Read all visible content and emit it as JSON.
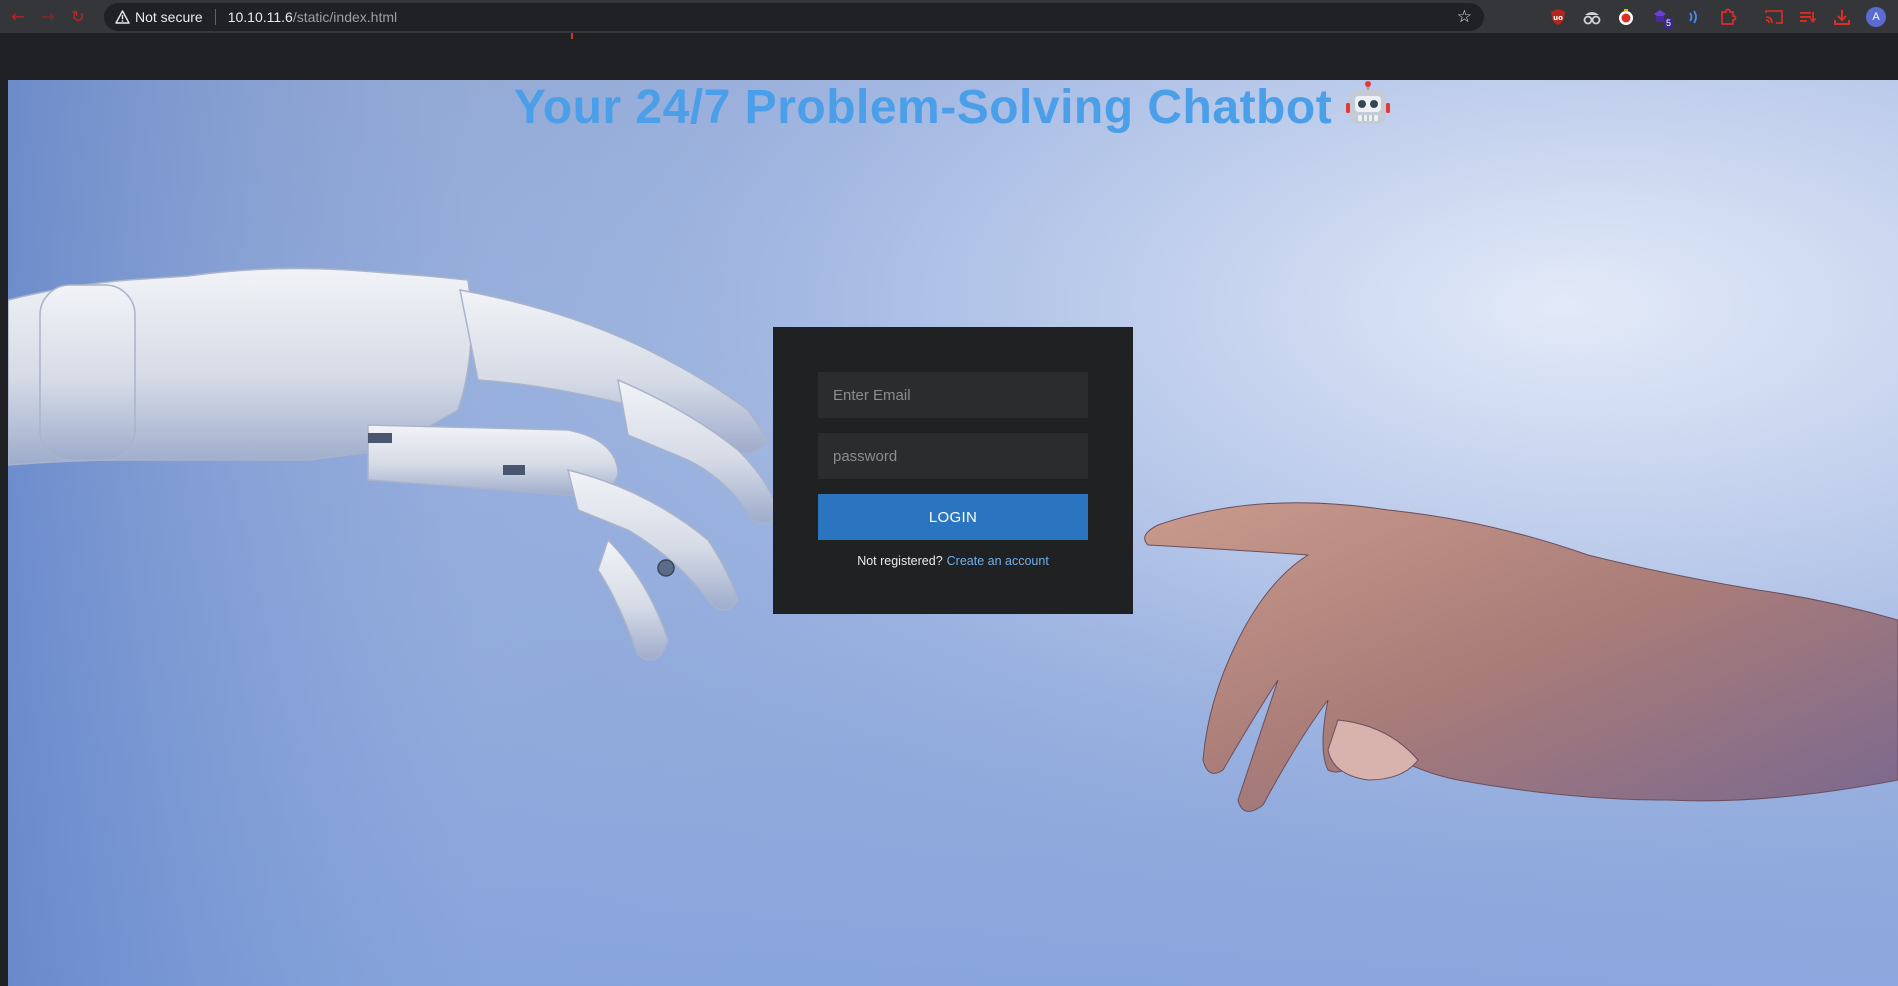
{
  "browser": {
    "security_label": "Not secure",
    "url_host": "10.10.11.6",
    "url_path": "/static/index.html",
    "accent_color": "#c5221f",
    "extensions": [
      "ublock-icon",
      "spy-icon",
      "stopwatch-icon",
      "extension-badge-icon",
      "wifi-waves-icon",
      "puzzle-icon",
      "cast-icon",
      "queue-icon",
      "download-icon"
    ],
    "extension_badge": "5",
    "avatar_initial": "A"
  },
  "page": {
    "title": "Your 24/7 Problem-Solving Chatbot",
    "title_emoji": "robot-face",
    "title_color": "#4a9fe8"
  },
  "login": {
    "email_placeholder": "Enter Email",
    "password_placeholder": "password",
    "button_label": "LOGIN",
    "register_prompt": "Not registered?",
    "register_link": "Create an account",
    "button_color": "#2a74c0",
    "link_color": "#6fb0ec"
  }
}
